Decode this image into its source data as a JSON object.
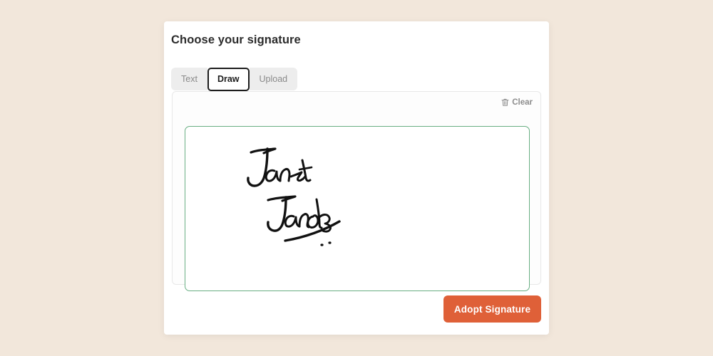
{
  "page": {
    "background_color": "#f2e7db"
  },
  "dialog": {
    "title": "Choose your signature",
    "tabs": [
      {
        "label": "Text",
        "active": false
      },
      {
        "label": "Draw",
        "active": true
      },
      {
        "label": "Upload",
        "active": false
      }
    ],
    "signature_panel": {
      "clear_label": "Clear",
      "clear_icon": "trash-icon",
      "canvas": {
        "border_color": "#68ae82",
        "ink_color": "#111111",
        "drawn_signature_text": "Janet Jacobs",
        "has_underline_flourish": true
      }
    },
    "primary_action": {
      "label": "Adopt Signature",
      "color": "#df6038",
      "text_color": "#ffffff"
    }
  }
}
